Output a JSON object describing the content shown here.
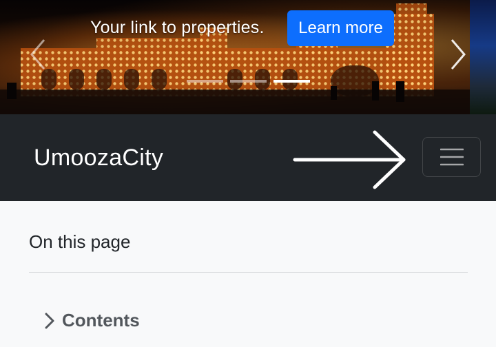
{
  "carousel": {
    "caption": "Your link to properties.",
    "button_label": "Learn more",
    "prev_icon": "chevron-left-icon",
    "next_icon": "chevron-right-icon",
    "indicator_count": 3,
    "active_indicator": 3
  },
  "navbar": {
    "brand": "UmoozaCity",
    "arrow_icon": "arrow-right-icon",
    "toggler_icon": "hamburger-menu-icon",
    "background": "#212529"
  },
  "toc": {
    "heading": "On this page",
    "toggle_label": "Contents",
    "toggle_icon": "chevron-right-icon"
  },
  "colors": {
    "primary_button": "#0d6efd",
    "page_background": "#f8f9fa"
  }
}
